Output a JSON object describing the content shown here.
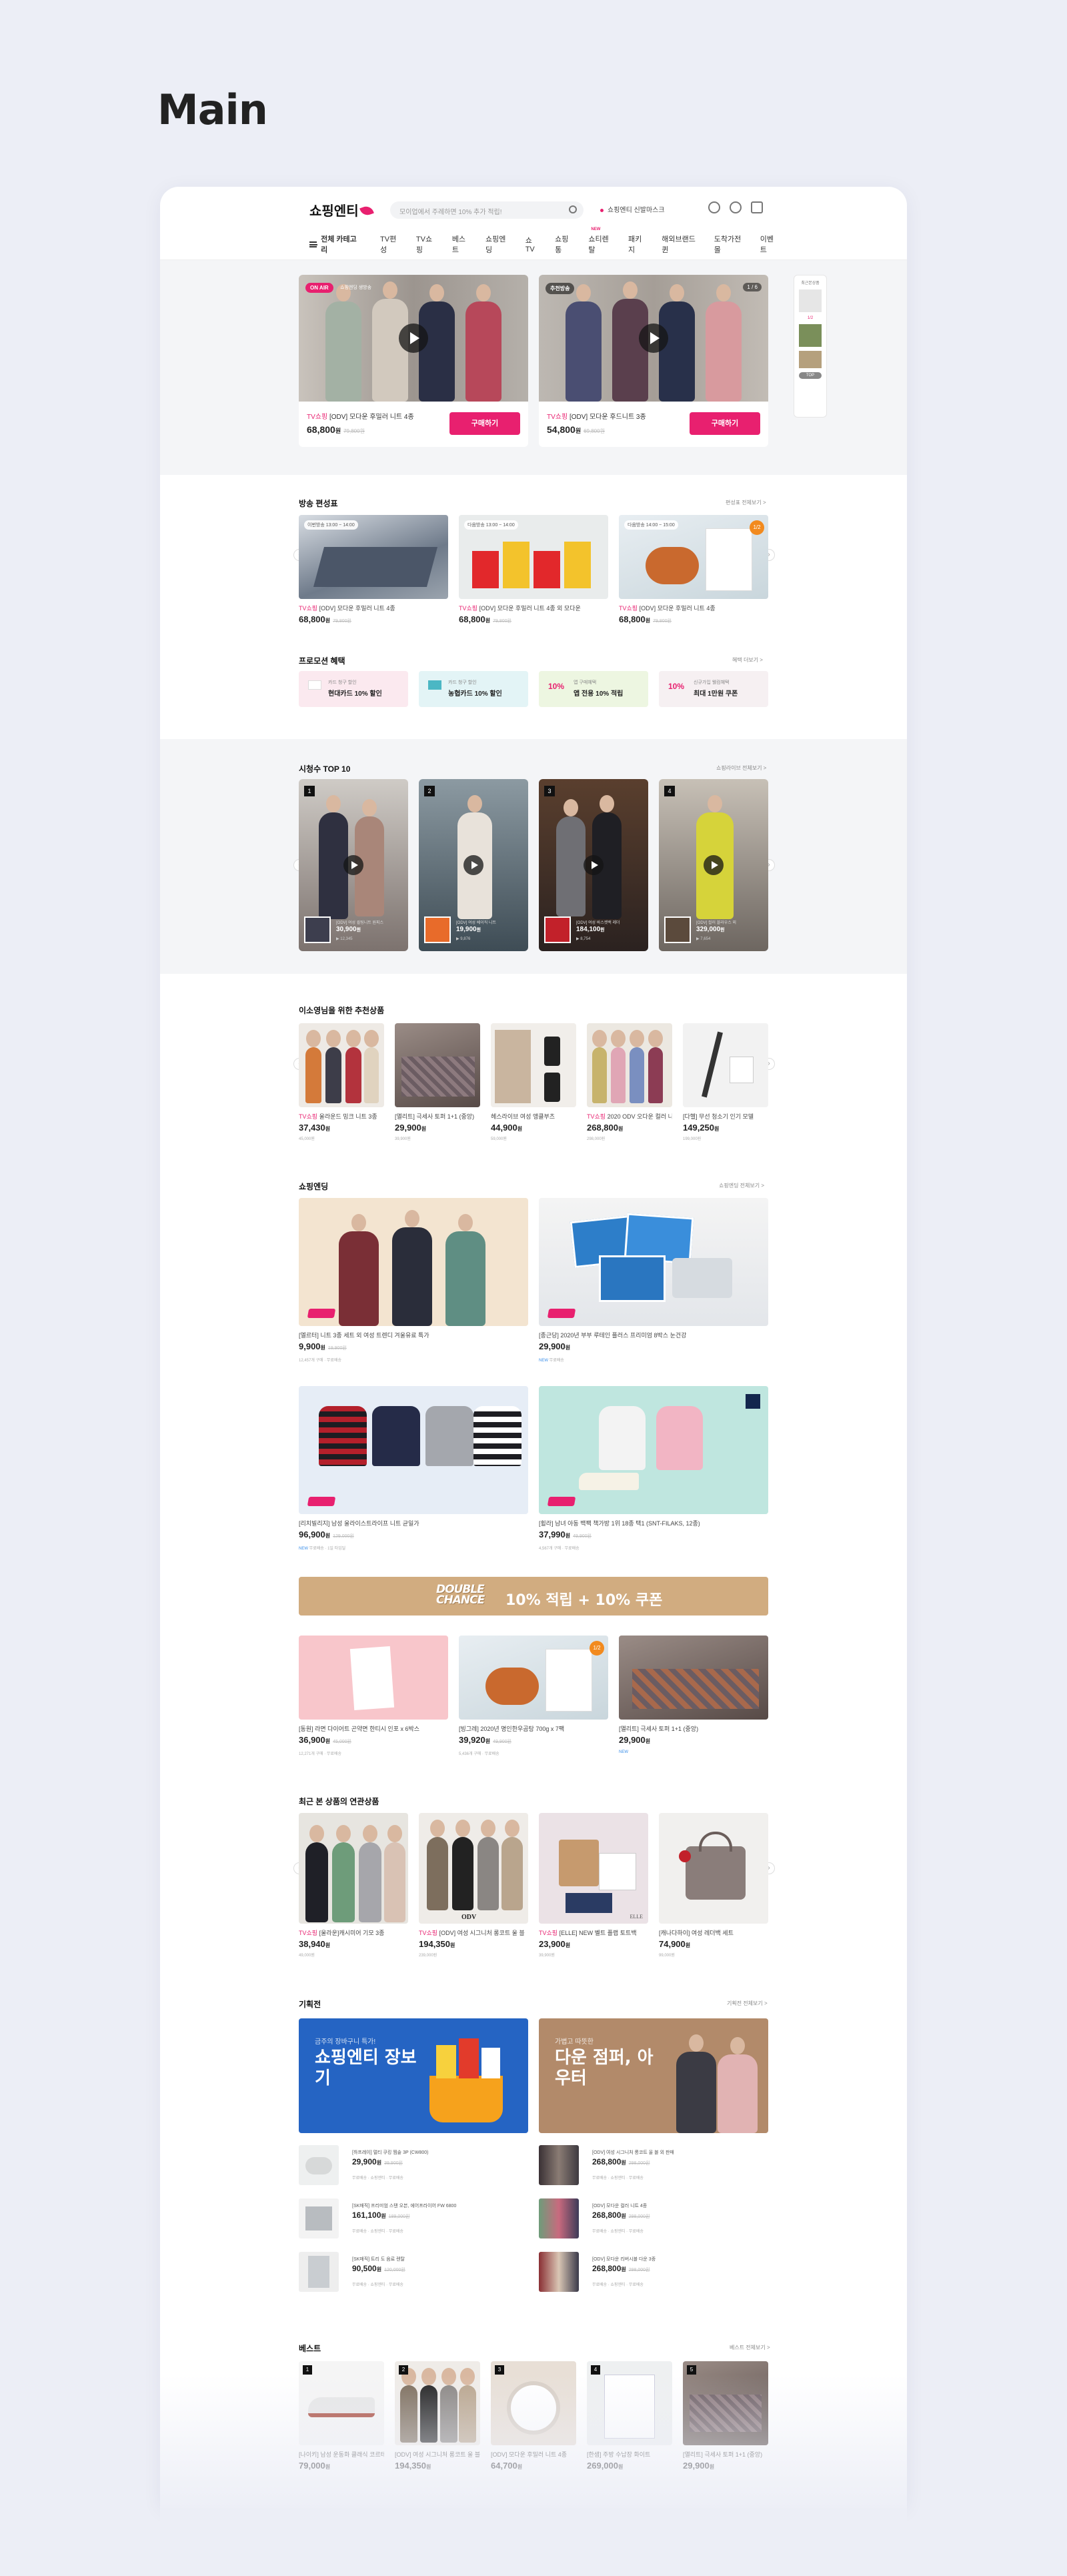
{
  "page_title": "Main",
  "header": {
    "logo": "쇼핑엔티",
    "search_placeholder": "모이업에서 주례하면 10% 추가 적립!",
    "live_text": "쇼핑엔티 신발마스크",
    "nav": {
      "category": "전체 카테고리",
      "items": [
        "TV편성",
        "TV쇼핑",
        "베스트",
        "쇼핑엔딩",
        "쇼TV",
        "쇼핑통",
        "쇼티렌탈",
        "패키지",
        "해외브랜드퀸",
        "도착가전몰",
        "이벤트"
      ],
      "new_badge": "NEW"
    }
  },
  "live": [
    {
      "tag": "ON AIR",
      "tag_text": "쇼핑엔딩 생방송",
      "title_prefix": "TV쇼핑",
      "title": "[ODV] 모다운 후밀러 니트 4종",
      "price": "68,800",
      "unit": "원",
      "old": "79,800원",
      "buy": "구매하기"
    },
    {
      "tag": "추천방송",
      "counter": "1 / 6",
      "title_prefix": "TV쇼핑",
      "title": "[ODV] 모다운 후드니트 3종",
      "price": "54,800",
      "unit": "원",
      "old": "69,800원",
      "buy": "구매하기"
    }
  ],
  "side": {
    "label": "최근본상품",
    "count": "1/2",
    "top": "TOP"
  },
  "schedule": {
    "title": "방송 편성표",
    "more": "편성표 전체보기 >",
    "items": [
      {
        "tag": "이번방송 13:00 ~ 14:00",
        "prefix": "TV쇼핑",
        "title": "[ODV] 모다운 후밀러 니트 4종",
        "price": "68,800",
        "unit": "원",
        "old": "79,800원"
      },
      {
        "tag": "다음방송 13:00 ~ 14:00",
        "prefix": "TV쇼핑",
        "title": "[ODV] 모다운 후밀러 니트 4종 외 모다운",
        "price": "68,800",
        "unit": "원",
        "old": "79,800원"
      },
      {
        "tag": "다음방송 14:00 ~ 15:00",
        "prefix": "TV쇼핑",
        "title": "[ODV] 모다운 후밀러 니트 4종",
        "price": "68,800",
        "unit": "원",
        "old": "79,800원"
      }
    ]
  },
  "promo": {
    "title": "프로모션 혜택",
    "more": "혜택 더보기 >",
    "items": [
      {
        "sub": "카드 청구 할인",
        "big": "현대카드 10% 할인",
        "color": "#fbe9ef"
      },
      {
        "sub": "카드 청구 할인",
        "big": "농협카드 10% 할인",
        "color": "#e3f4f6"
      },
      {
        "pct": "10%",
        "sub": "앱 구매혜택",
        "big": "앱 전용 10% 적립",
        "color": "#edf6e1"
      },
      {
        "pct": "10%",
        "sub": "신규가입 웰컴혜택",
        "big": "최대 1만원 쿠폰",
        "color": "#f6f0f2"
      }
    ]
  },
  "top10": {
    "title": "시청수 TOP 10",
    "more": "쇼핑라이브 전체보기 >",
    "items": [
      {
        "num": "1",
        "title": "[ODV] 여성 퀼팅니트 원피스",
        "price": "30,900",
        "unit": "원",
        "views": "12,345"
      },
      {
        "num": "2",
        "title": "[ODV] 여성 베이직 니트",
        "price": "19,900",
        "unit": "원",
        "views": "9,876"
      },
      {
        "num": "3",
        "title": "[ODV] 여성 바스켓백 레더",
        "price": "184,100",
        "unit": "원",
        "views": "8,754"
      },
      {
        "num": "4",
        "title": "[ODV] 컬러 블라우스 외",
        "price": "329,000",
        "unit": "원",
        "views": "7,654"
      }
    ]
  },
  "recommend": {
    "title": "이소영님을 위한 추천상품",
    "items": [
      {
        "prefix": "TV쇼핑",
        "title": "울라운드 밍크 니트 3종",
        "price": "37,430",
        "unit": "원",
        "old": "45,000원"
      },
      {
        "title": "[앨리트] 극세사 토퍼 1+1 (중앙)",
        "price": "29,900",
        "unit": "원",
        "old": "39,900원"
      },
      {
        "title": "헤스라이브 여성 앵클부츠",
        "price": "44,900",
        "unit": "원",
        "old": "59,000원"
      },
      {
        "prefix": "TV쇼핑",
        "title": "2020 ODV 오다운 컬러 니트",
        "price": "268,800",
        "unit": "원",
        "old": "298,000원"
      },
      {
        "title": "[다헬] 무선 청소기 인기 모델",
        "price": "149,250",
        "unit": "원",
        "old": "199,000원"
      }
    ]
  },
  "showending": {
    "title": "쇼핑엔딩",
    "more": "쇼핑엔딩 전체보기 >",
    "items": [
      {
        "title": "[엘르터] 니트 3종 세트 외 여성 트렌디 겨울유료 특가",
        "price": "9,900",
        "unit": "원",
        "old": "19,900원",
        "meta": "12,457개 구매 · 무료배송"
      },
      {
        "title": "[종근당] 2020년 부부 루테인 플러스 프리미엄 8박스 눈건강",
        "price": "29,900",
        "unit": "원",
        "old": "",
        "badge": "NEW",
        "meta": "무료배송"
      },
      {
        "title": "[리치빌리지] 남성 울라이스트라이프 니트 균일가",
        "price": "96,900",
        "unit": "원",
        "old": "129,000원",
        "badge": "NEW",
        "meta": "무료배송 · 1일 타임딜"
      },
      {
        "title": "[휠라] 남녀 아동 백팩 책가방 1위 18종 택1 (SNT-FILAKS, 12종)",
        "price": "37,990",
        "unit": "원",
        "old": "49,900원",
        "meta": "4,567개 구매 · 무료배송"
      }
    ]
  },
  "banner": {
    "double": "DOUBLE",
    "chance": "CHANCE",
    "text": "10% 적립 + 10% 쿠폰"
  },
  "triple": [
    {
      "title": "[동원] 라면 다이어트 곤약면 한티시 인포 x 6박스",
      "price": "36,900",
      "unit": "원",
      "old": "45,000원",
      "meta": "12,271개 구매 · 무료배송"
    },
    {
      "title": "[빙그레] 2020년 명인한우곰탕 700g x 7팩",
      "price": "39,920",
      "unit": "원",
      "old": "49,900원",
      "meta": "5,436개 구매 · 무료배송"
    },
    {
      "title": "[앨리트] 극세사 토퍼 1+1 (중앙)",
      "price": "29,900",
      "unit": "원",
      "old": "",
      "badge": "NEW",
      "meta": "무료배송"
    }
  ],
  "related": {
    "title": "최근 본 상품의 연관상품",
    "items": [
      {
        "prefix": "TV쇼핑",
        "title": "[울라운]캐시미어 기모 3종",
        "price": "38,940",
        "unit": "원",
        "old": "49,000원"
      },
      {
        "prefix": "TV쇼핑",
        "title": "[ODV] 여성 시그니처 롱코트 울 블",
        "price": "194,350",
        "unit": "원",
        "old": "239,000원"
      },
      {
        "prefix": "TV쇼핑",
        "title": "[ELLE] NEW 벨트 플랩 토트백",
        "price": "23,900",
        "unit": "원",
        "old": "39,900원"
      },
      {
        "title": "[캐나다하이] 여성 레더백 세트",
        "price": "74,900",
        "unit": "원",
        "old": "99,000원"
      }
    ]
  },
  "plans": {
    "title": "기획전",
    "more": "기획전 전체보기 >",
    "left": {
      "sub": "금주의 장바구니 특가!",
      "big": "쇼핑엔티 장보기"
    },
    "right": {
      "sub": "가볍고 따뜻한",
      "big": "다운 점퍼, 아우터"
    },
    "left_items": [
      {
        "title": "[하프레이] 멀티 쿠킹 찜솥 3P (CW800)",
        "price": "29,900",
        "unit": "원",
        "old": "39,900원",
        "meta": "무료배송 · 쇼핑엔티 · 무료배송"
      },
      {
        "title": "[SK매직] 프리미엄 스탠 오븐, 에어프라이어 FW 6800",
        "price": "161,100",
        "unit": "원",
        "old": "189,000원",
        "meta": "무료배송 · 쇼핑엔티 · 무료배송"
      },
      {
        "title": "[SK매직] 트리 도 음료 렌탈",
        "price": "90,500",
        "unit": "원",
        "old": "120,000원",
        "meta": "무료배송 · 쇼핑엔티 · 무료배송"
      }
    ],
    "right_items": [
      {
        "title": "[ODV] 여성 시그니처 롱코트 울 블 외 판매",
        "price": "268,800",
        "unit": "원",
        "old": "298,000원",
        "meta": "무료배송 · 쇼핑엔티 · 무료배송"
      },
      {
        "title": "[ODV] 모다운 컬러 니트 4종",
        "price": "268,800",
        "unit": "원",
        "old": "298,000원",
        "meta": "무료배송 · 쇼핑엔티 · 무료배송"
      },
      {
        "title": "[ODV] 모다운 리버시블 다운 3종",
        "price": "268,800",
        "unit": "원",
        "old": "298,000원",
        "meta": "무료배송 · 쇼핑엔티 · 무료배송"
      }
    ]
  },
  "best": {
    "title": "베스트",
    "more": "베스트 전체보기 >",
    "items": [
      {
        "num": "1",
        "title": "[나이키] 남성 운동화 클래식 코르테즈",
        "price": "79,000",
        "unit": "원"
      },
      {
        "num": "2",
        "title": "[ODV] 여성 시그니처 롱코트 울 블 외",
        "price": "194,350",
        "unit": "원"
      },
      {
        "num": "3",
        "title": "[ODV] 모다운 후밀러 니트 4종",
        "price": "64,700",
        "unit": "원"
      },
      {
        "num": "4",
        "title": "[한샘] 주방 수납장 화이트",
        "price": "269,000",
        "unit": "원"
      },
      {
        "num": "5",
        "title": "[앨리트] 극세사 토퍼 1+1 (중앙)",
        "price": "29,900",
        "unit": "원"
      }
    ]
  }
}
